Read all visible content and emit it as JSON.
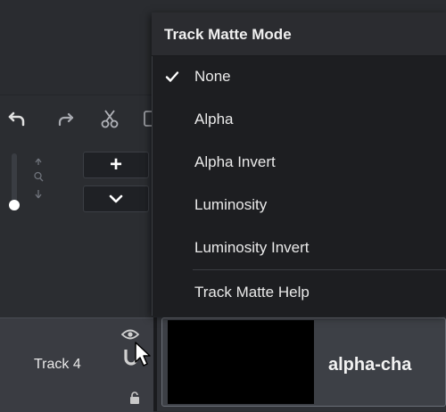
{
  "menu": {
    "title": "Track Matte Mode",
    "items": [
      {
        "label": "None",
        "checked": true
      },
      {
        "label": "Alpha",
        "checked": false
      },
      {
        "label": "Alpha Invert",
        "checked": false
      },
      {
        "label": "Luminosity",
        "checked": false
      },
      {
        "label": "Luminosity Invert",
        "checked": false
      },
      {
        "label": "Track Matte Help",
        "checked": false
      }
    ]
  },
  "toolbar": {
    "icons": [
      "undo-icon",
      "redo-icon",
      "cut-icon",
      "copy-icon"
    ],
    "zoom_in_glyph": "+",
    "zoom_expand_glyph": "chevron-down-icon"
  },
  "track": {
    "label": "Track 4",
    "icons": [
      "eye-icon",
      "magnet-icon",
      "lock-icon"
    ],
    "clip_name": "alpha-cha"
  },
  "colors": {
    "menu_bg": "#1d1e21",
    "menu_header_bg": "#2b2c30",
    "app_bg": "#2b2d31",
    "track_header_bg": "#3a3c42"
  }
}
